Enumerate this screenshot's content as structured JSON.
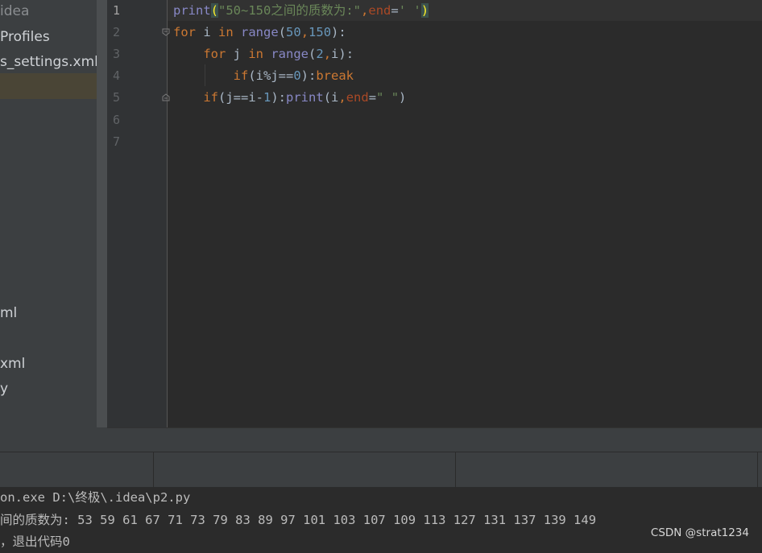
{
  "sidebar": {
    "items": [
      {
        "label": "idea"
      },
      {
        "label": "Profiles"
      },
      {
        "label": "s_settings.xml"
      },
      {
        "label": "ml"
      },
      {
        "label": "xml"
      },
      {
        "label": "y"
      }
    ]
  },
  "editor": {
    "line_numbers": [
      "1",
      "2",
      "3",
      "4",
      "5",
      "6",
      "7"
    ],
    "lines": {
      "l1": {
        "fn": "print",
        "open": "(",
        "str": "\"50~150之间的质数为:\"",
        "comma": ",",
        "kw": "end",
        "eq": "=",
        "str2": "' '",
        "close": ")"
      },
      "l2": {
        "kw_for": "for",
        "var": " i ",
        "kw_in": "in",
        "sp": " ",
        "fn": "range",
        "open": "(",
        "n1": "50",
        "comma": ",",
        "n2": "150",
        "close": "):"
      },
      "l3": {
        "indent": "    ",
        "kw_for": "for",
        "var": " j ",
        "kw_in": "in",
        "sp": " ",
        "fn": "range",
        "open": "(",
        "n1": "2",
        "comma": ",",
        "var2": "i",
        "close": "):"
      },
      "l4": {
        "indent": "        ",
        "kw_if": "if",
        "expr1": "(i%j==",
        "n": "0",
        "expr2": "):",
        "kw_break": "break"
      },
      "l5": {
        "indent": "    ",
        "kw_if": "if",
        "expr1": "(j==i-",
        "n": "1",
        "expr2": "):",
        "fn": "print",
        "args": "(i",
        "comma": ",",
        "kw": "end",
        "eq": "=",
        "str": "\" \"",
        "close": ")"
      }
    }
  },
  "console": {
    "lines": [
      "on.exe D:\\终极\\.idea\\p2.py",
      "间的质数为: 53 59 61 67 71 73 79 83 89 97 101 103 107 109 113 127 131 137 139 149",
      "，退出代码0"
    ]
  },
  "watermark": "CSDN @strat1234",
  "colors": {
    "background": "#2b2b2b",
    "keyword": "#cc7832",
    "builtin": "#8888c6",
    "number": "#6897bb",
    "string": "#6a8759",
    "param": "#aa4926"
  }
}
